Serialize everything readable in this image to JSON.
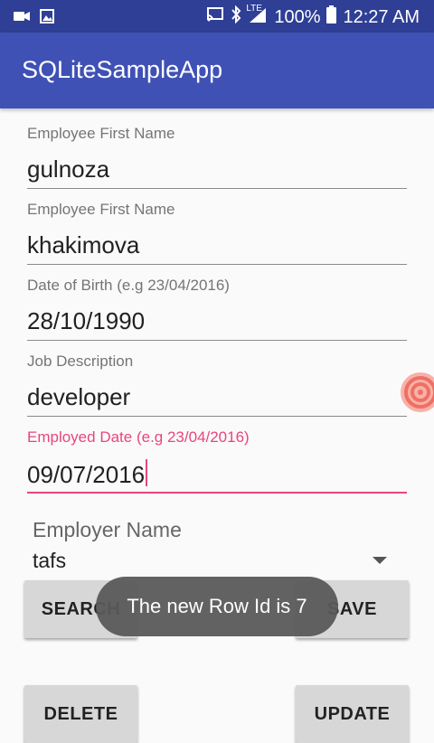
{
  "status_bar": {
    "battery_percent": "100%",
    "time": "12:27 AM",
    "network": "LTE"
  },
  "app_bar": {
    "title": "SQLiteSampleApp"
  },
  "fields": [
    {
      "label": "Employee First Name",
      "value": "gulnoza"
    },
    {
      "label": "Employee First Name",
      "value": "khakimova"
    },
    {
      "label": "Date of Birth (e.g 23/04/2016)",
      "value": "28/10/1990"
    },
    {
      "label": "Job Description",
      "value": "developer"
    },
    {
      "label": "Employed Date (e.g 23/04/2016)",
      "value": "09/07/2016"
    }
  ],
  "spinner": {
    "label": "Employer Name",
    "selected": "tafs"
  },
  "buttons": {
    "search": "SEARCH",
    "save": "SAVE",
    "delete": "DELETE",
    "update": "UPDATE"
  },
  "toast": {
    "message": "The new Row Id is 7"
  },
  "colors": {
    "primary": "#3f51b5",
    "primary_dark": "#2f3f95",
    "accent": "#e8467c"
  }
}
